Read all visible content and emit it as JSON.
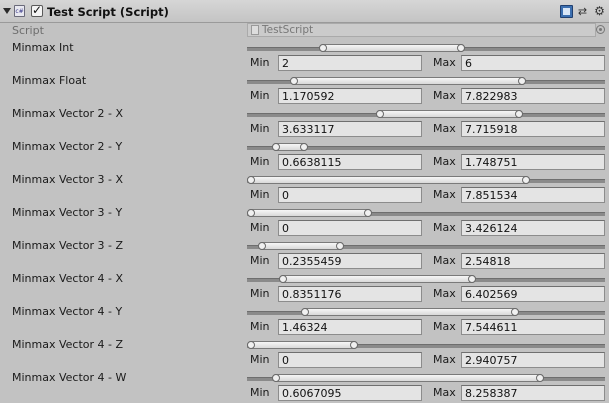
{
  "component": {
    "title": "Test Script (Script)",
    "enabled": true,
    "script_label": "Script",
    "script_value": "TestScript"
  },
  "labels": {
    "min": "Min",
    "max": "Max"
  },
  "fields": [
    {
      "label": "Minmax Int",
      "min": "2",
      "max": "6",
      "range_start": 0.2,
      "range_end": 0.61
    },
    {
      "label": "Minmax Float",
      "min": "1.170592",
      "max": "7.822983",
      "range_start": 0.12,
      "range_end": 0.78
    },
    {
      "label": "Minmax Vector 2 - X",
      "min": "3.633117",
      "max": "7.715918",
      "range_start": 0.36,
      "range_end": 0.77
    },
    {
      "label": "Minmax Vector 2 - Y",
      "min": "0.6638115",
      "max": "1.748751",
      "range_start": 0.07,
      "range_end": 0.17
    },
    {
      "label": "Minmax Vector 3 - X",
      "min": "0",
      "max": "7.851534",
      "range_start": 0.0,
      "range_end": 0.79
    },
    {
      "label": "Minmax Vector 3 - Y",
      "min": "0",
      "max": "3.426124",
      "range_start": 0.0,
      "range_end": 0.35
    },
    {
      "label": "Minmax Vector 3 - Z",
      "min": "0.2355459",
      "max": "2.54818",
      "range_start": 0.03,
      "range_end": 0.27
    },
    {
      "label": "Minmax Vector 4 - X",
      "min": "0.8351176",
      "max": "6.402569",
      "range_start": 0.09,
      "range_end": 0.64
    },
    {
      "label": "Minmax Vector 4 - Y",
      "min": "1.46324",
      "max": "7.544611",
      "range_start": 0.15,
      "range_end": 0.76
    },
    {
      "label": "Minmax Vector 4 - Z",
      "min": "0",
      "max": "2.940757",
      "range_start": 0.0,
      "range_end": 0.31
    },
    {
      "label": "Minmax Vector 4 - W",
      "min": "0.6067095",
      "max": "8.258387",
      "range_start": 0.07,
      "range_end": 0.83
    }
  ]
}
